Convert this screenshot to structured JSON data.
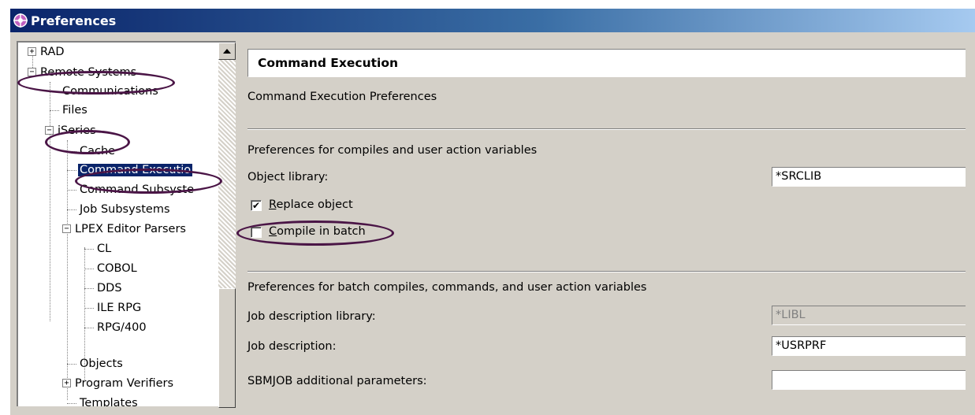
{
  "window": {
    "title": "Preferences",
    "icon": "preferences-gear-icon"
  },
  "tree": {
    "items": [
      {
        "label": "RAD",
        "toggle": "+"
      },
      {
        "label": "Remote Systems",
        "toggle": "−"
      },
      {
        "label": "Communications"
      },
      {
        "label": "Files"
      },
      {
        "label": "iSeries",
        "toggle": "−"
      },
      {
        "label": "Cache"
      },
      {
        "label": "Command Executio",
        "selected": true
      },
      {
        "label": "Command Subsyste"
      },
      {
        "label": "Job Subsystems"
      },
      {
        "label": "LPEX Editor Parsers",
        "toggle": "−"
      },
      {
        "label": "CL"
      },
      {
        "label": "COBOL"
      },
      {
        "label": "DDS"
      },
      {
        "label": "ILE RPG"
      },
      {
        "label": "RPG/400"
      },
      {
        "label": "Objects"
      },
      {
        "label": "Program Verifiers",
        "toggle": "+"
      },
      {
        "label": "Templates"
      }
    ]
  },
  "page": {
    "title": "Command Execution",
    "description": "Command Execution Preferences",
    "compile_section": {
      "heading": "Preferences for compiles and user action variables",
      "object_library_label": "Object library:",
      "object_library_value": "*SRCLIB",
      "replace_object_label": "Replace object",
      "replace_object_mnemonic": "R",
      "replace_object_rest": "eplace object",
      "replace_object_checked": true,
      "compile_in_batch_label": "Compile in batch",
      "compile_in_batch_mnemonic": "C",
      "compile_in_batch_rest": "ompile in batch",
      "compile_in_batch_checked": false
    },
    "batch_section": {
      "heading": "Preferences for batch compiles, commands, and user action variables",
      "job_desc_library_label": "Job description library:",
      "job_desc_library_value": "*LIBL",
      "job_desc_label": "Job description:",
      "job_desc_value": "*USRPRF",
      "sbmjob_label": "SBMJOB additional parameters:",
      "sbmjob_value": ""
    }
  },
  "annotation_color": "#4a1546"
}
